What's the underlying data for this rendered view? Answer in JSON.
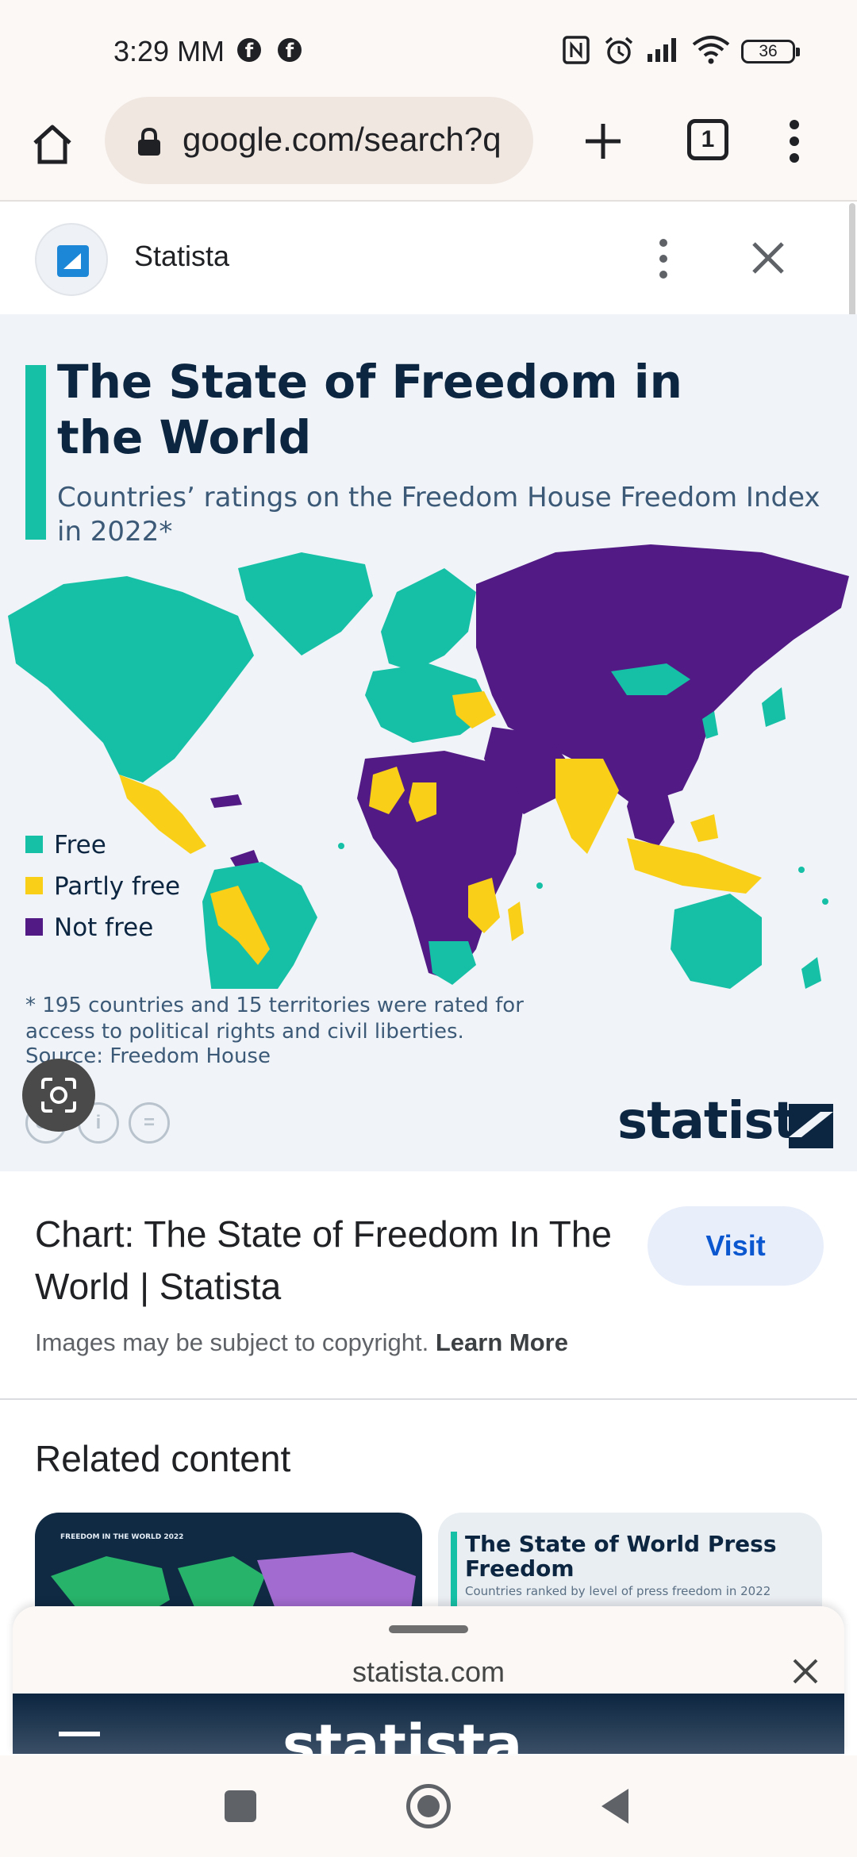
{
  "status_bar": {
    "time": "3:29 MM",
    "battery": "36",
    "icons": [
      "facebook-icon",
      "facebook-icon",
      "nfc-icon",
      "alarm-icon",
      "signal-icon",
      "wifi-icon",
      "battery-icon"
    ]
  },
  "toolbar": {
    "url": "google.com/search?q",
    "tab_count": "1",
    "icons": [
      "home-icon",
      "lock-icon",
      "plus-icon",
      "tab-switcher-icon",
      "more-vert-icon"
    ]
  },
  "panel": {
    "site_name": "Statista",
    "icons": [
      "statista-favicon",
      "more-vert-icon",
      "close-icon"
    ]
  },
  "infographic": {
    "title": "The State of Freedom in the World",
    "subtitle": "Countries’ ratings on the Freedom House Freedom Index in 2022*",
    "legend": [
      {
        "label": "Free",
        "color": "#16c0a6"
      },
      {
        "label": "Partly free",
        "color": "#f9cf17"
      },
      {
        "label": "Not free",
        "color": "#521a84"
      }
    ],
    "footnote": "* 195 countries and 15 territories were rated for access to political rights and civil liberties.",
    "source": "Source: Freedom House",
    "brand": "statista",
    "license_icons": [
      "cc-icon",
      "attribution-icon",
      "no-derivatives-icon"
    ]
  },
  "result": {
    "title": "Chart: The State of Freedom In The World | Statista",
    "visit_label": "Visit",
    "copyright_text": "Images may be subject to copyright.",
    "learn_more": "Learn More"
  },
  "related": {
    "heading": "Related content",
    "cards": [
      {
        "label": "FREEDOM IN THE WORLD 2022"
      },
      {
        "title": "The State of World Press Freedom",
        "subtitle": "Countries ranked by level of press freedom in 2022"
      }
    ]
  },
  "sheet": {
    "domain": "statista.com",
    "preview_brand": "statista"
  },
  "navbar": {
    "icons": [
      "recents-icon",
      "home-icon",
      "back-icon"
    ]
  }
}
